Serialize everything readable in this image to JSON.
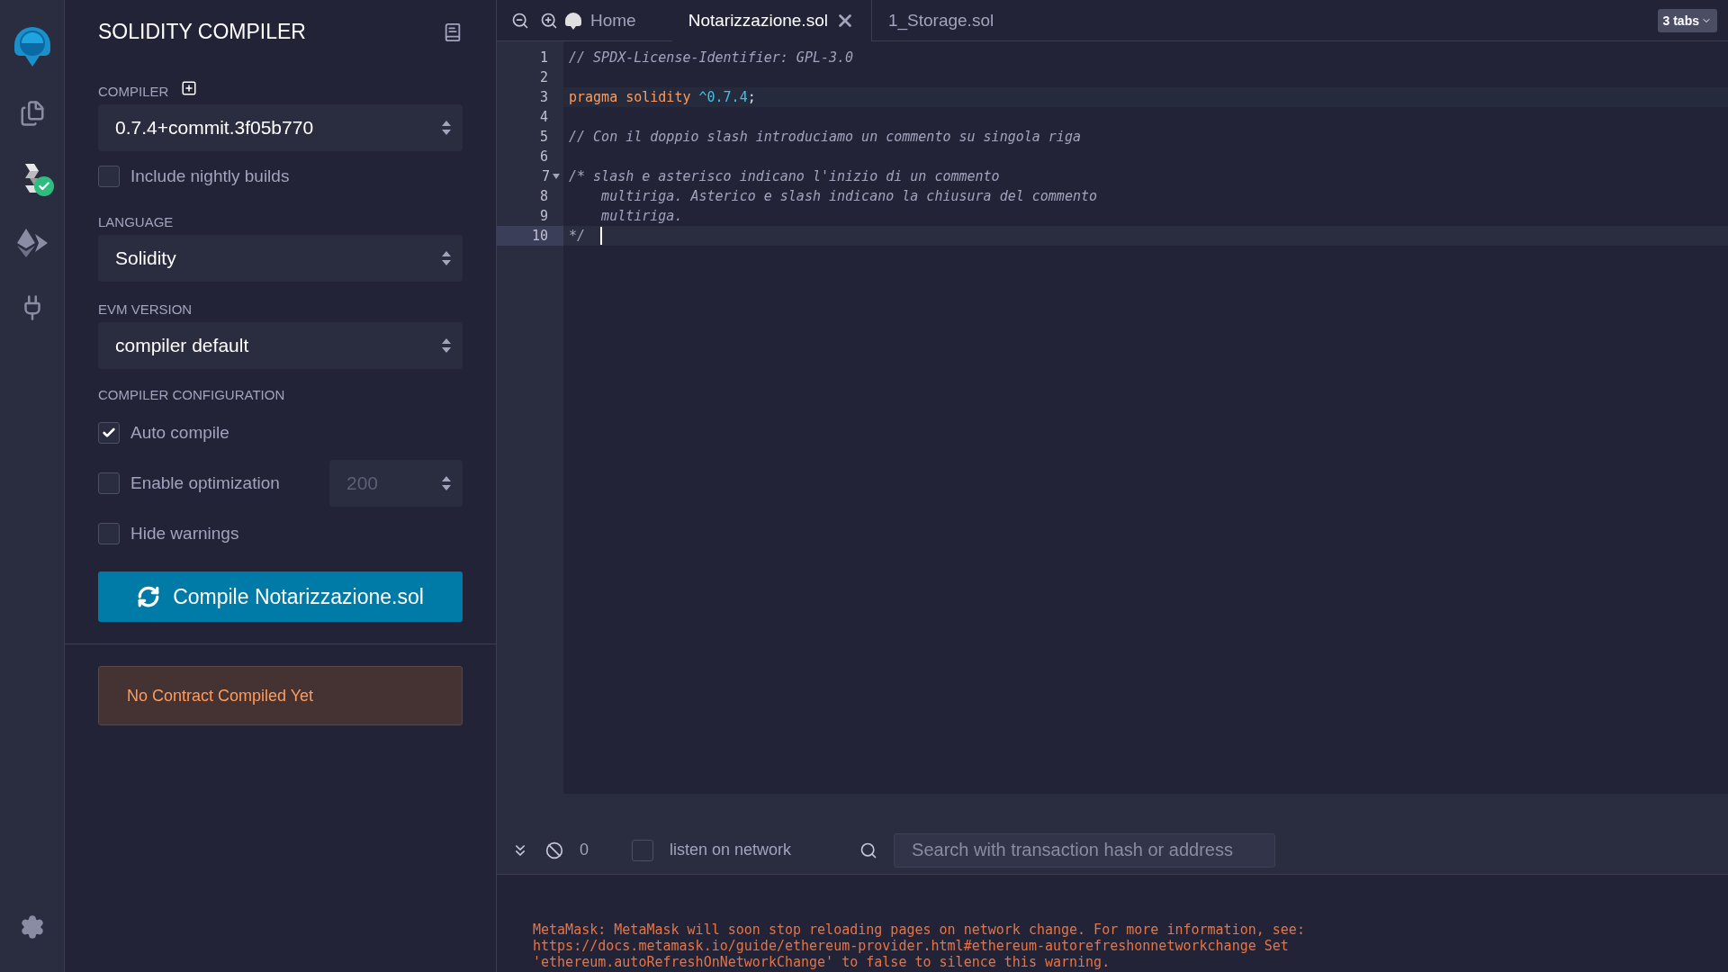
{
  "icon_panel": {
    "items": [
      {
        "kind": "files",
        "selected": false
      },
      {
        "kind": "compiler",
        "selected": true
      },
      {
        "kind": "deploy",
        "selected": false
      },
      {
        "kind": "plugins",
        "selected": false
      }
    ]
  },
  "sidebar": {
    "title": "SOLIDITY COMPILER",
    "compiler": {
      "label": "COMPILER",
      "value": "0.7.4+commit.3f05b770"
    },
    "nightly": {
      "label": "Include nightly builds",
      "checked": false
    },
    "language": {
      "label": "LANGUAGE",
      "value": "Solidity"
    },
    "evm": {
      "label": "EVM VERSION",
      "value": "compiler default"
    },
    "config": {
      "label": "COMPILER CONFIGURATION",
      "options": [
        {
          "label": "Auto compile",
          "checked": true
        },
        {
          "label": "Enable optimization",
          "checked": false,
          "runs": "200"
        },
        {
          "label": "Hide warnings",
          "checked": false
        }
      ]
    },
    "compile_button": "Compile Notarizzazione.sol",
    "status": "No Contract Compiled Yet"
  },
  "tabs": [
    {
      "label": "Home",
      "kind": "home",
      "selected": false
    },
    {
      "label": "Notarizzazione.sol",
      "kind": "file",
      "selected": true
    },
    {
      "label": "1_Storage.sol",
      "kind": "file",
      "selected": false
    }
  ],
  "tab_count": "3 tabs",
  "editor": {
    "lines": [
      {
        "number": "1",
        "active": false,
        "highlighted": false,
        "foldable": false,
        "segments": [
          {
            "kind": "comment",
            "text": "// SPDX-License-Identifier: GPL-3.0"
          }
        ]
      },
      {
        "number": "2",
        "active": false,
        "highlighted": false,
        "foldable": false
      },
      {
        "number": "3",
        "active": false,
        "highlighted": true,
        "foldable": false,
        "segments": [
          {
            "kind": "keyword",
            "text": "pragma solidity "
          },
          {
            "kind": "number",
            "text": "^0.7.4"
          },
          {
            "kind": "plain",
            "text": ";"
          }
        ]
      },
      {
        "number": "4",
        "active": false,
        "highlighted": false,
        "foldable": false
      },
      {
        "number": "5",
        "active": false,
        "highlighted": false,
        "foldable": false,
        "segments": [
          {
            "kind": "comment",
            "text": "// Con il doppio slash introduciamo un commento su singola riga"
          }
        ]
      },
      {
        "number": "6",
        "active": false,
        "highlighted": false,
        "foldable": false
      },
      {
        "number": "7",
        "active": false,
        "highlighted": false,
        "foldable": true,
        "segments": [
          {
            "kind": "comment",
            "text": "/* slash e asterisco indicano l'inizio di un commento"
          }
        ]
      },
      {
        "number": "8",
        "active": false,
        "highlighted": false,
        "foldable": false,
        "segments": [
          {
            "kind": "comment",
            "text": "    multiriga. Asterico e slash indicano la chiusura del commento"
          }
        ]
      },
      {
        "number": "9",
        "active": false,
        "highlighted": false,
        "foldable": false,
        "segments": [
          {
            "kind": "comment",
            "text": "    multiriga."
          }
        ]
      },
      {
        "number": "10",
        "active": true,
        "highlighted": false,
        "foldable": false,
        "segments": [
          {
            "kind": "comment",
            "text": "*/ "
          }
        ]
      }
    ]
  },
  "terminal": {
    "pending_count": "0",
    "listen": {
      "label": "listen on network",
      "checked": false
    },
    "search": {
      "placeholder": "Search with transaction hash or address"
    },
    "log": [
      "MetaMask: MetaMask will soon stop reloading pages on network change. For more information, see:",
      "https://docs.metamask.io/guide/ethereum-provider.html#ethereum-autorefreshonnetworkchange Set",
      "'ethereum.autoRefreshOnNetworkChange' to false to silence this warning."
    ]
  }
}
